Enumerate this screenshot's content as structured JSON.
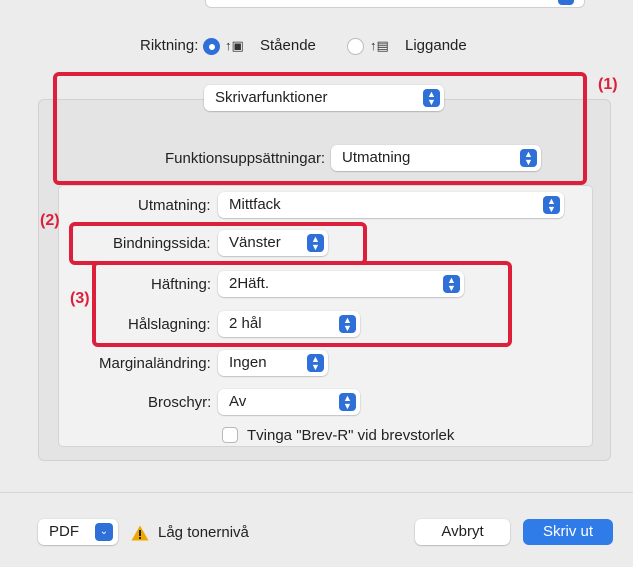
{
  "orientation": {
    "label": "Riktning:",
    "portrait": "Stående",
    "landscape": "Liggande",
    "selected": "portrait"
  },
  "panel_select": {
    "value": "Skrivarfunktioner"
  },
  "feature_sets": {
    "label": "Funktionsuppsättningar:",
    "value": "Utmatning"
  },
  "output": {
    "label": "Utmatning:",
    "value": "Mittfack"
  },
  "binding": {
    "label": "Bindningssida:",
    "value": "Vänster"
  },
  "stapling": {
    "label": "Häftning:",
    "value": "2Häft."
  },
  "punching": {
    "label": "Hålslagning:",
    "value": "2 hål"
  },
  "margin": {
    "label": "Marginaländring:",
    "value": "Ingen"
  },
  "booklet": {
    "label": "Broschyr:",
    "value": "Av"
  },
  "force_letter": {
    "label": "Tvinga \"Brev-R\" vid brevstorlek",
    "checked": false
  },
  "callouts": {
    "c1": "(1)",
    "c2": "(2)",
    "c3": "(3)"
  },
  "footer": {
    "pdf_label": "PDF",
    "warning_text": "Låg tonernivå",
    "cancel_label": "Avbryt",
    "print_label": "Skriv ut"
  },
  "colors": {
    "accent": "#2e6fd8",
    "callout": "#dc1f3b",
    "warning": "#f0a800"
  }
}
